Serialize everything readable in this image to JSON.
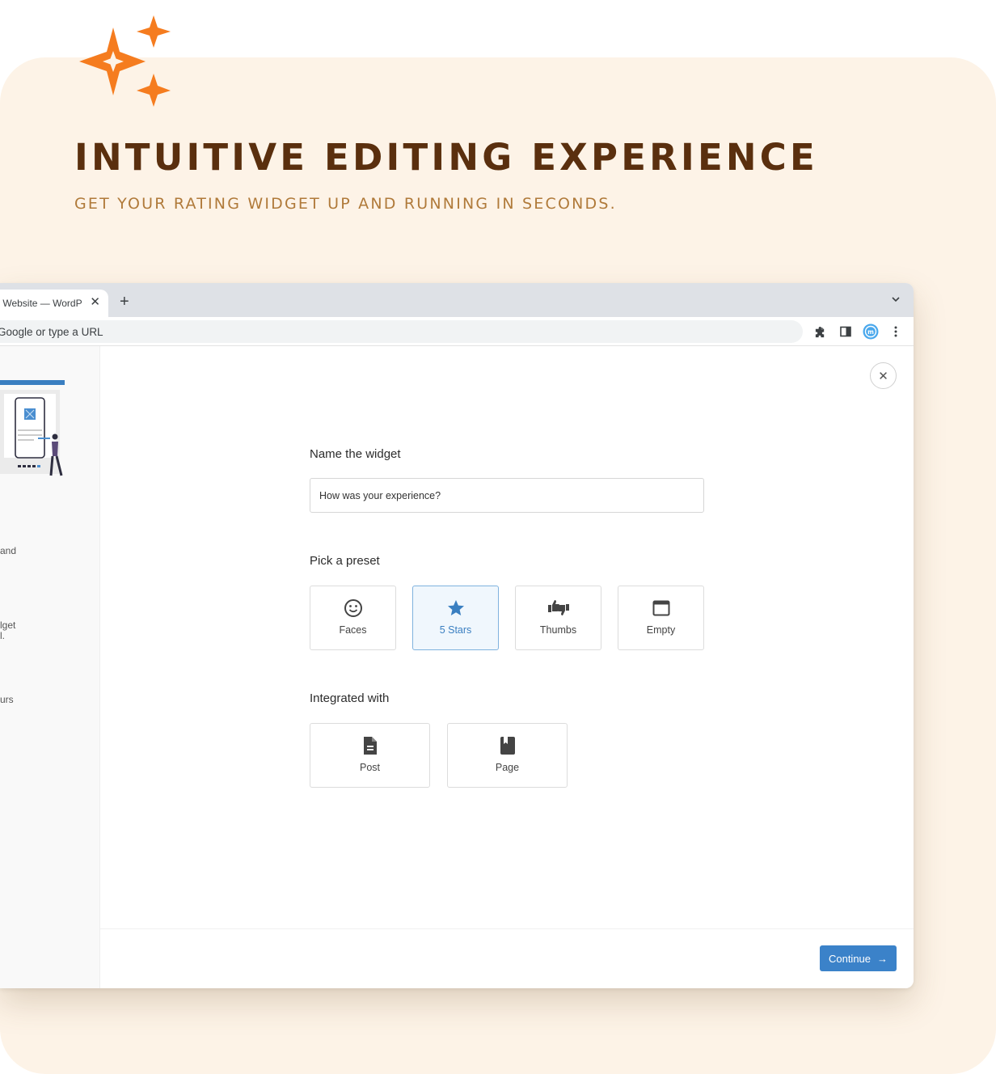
{
  "hero": {
    "title": "INTUITIVE EDITING EXPERIENCE",
    "subtitle": "GET YOUR RATING WIDGET UP AND RUNNING IN SECONDS."
  },
  "browser": {
    "tab_title": "‹ Website — WordP",
    "omnibox_text": "Google or type a URL"
  },
  "sidebar": {
    "snippets": [
      "and",
      "lget",
      "l.",
      "urs"
    ]
  },
  "form": {
    "name_label": "Name the widget",
    "name_value": "How was your experience?",
    "preset_label": "Pick a preset",
    "presets": [
      {
        "label": "Faces",
        "icon": "smiley-face-icon"
      },
      {
        "label": "5 Stars",
        "icon": "star-icon",
        "selected": true
      },
      {
        "label": "Thumbs",
        "icon": "thumbs-icon"
      },
      {
        "label": "Empty",
        "icon": "empty-window-icon"
      }
    ],
    "integration_label": "Integrated with",
    "integrations": [
      {
        "label": "Post",
        "icon": "document-icon"
      },
      {
        "label": "Page",
        "icon": "bookmark-page-icon"
      }
    ],
    "continue_label": "Continue"
  },
  "colors": {
    "accent": "#3b82c9",
    "sparkle": "#f57c1f",
    "headline": "#5a2f0e",
    "subhead": "#b07a3a",
    "panel_bg": "#fdf3e7"
  }
}
